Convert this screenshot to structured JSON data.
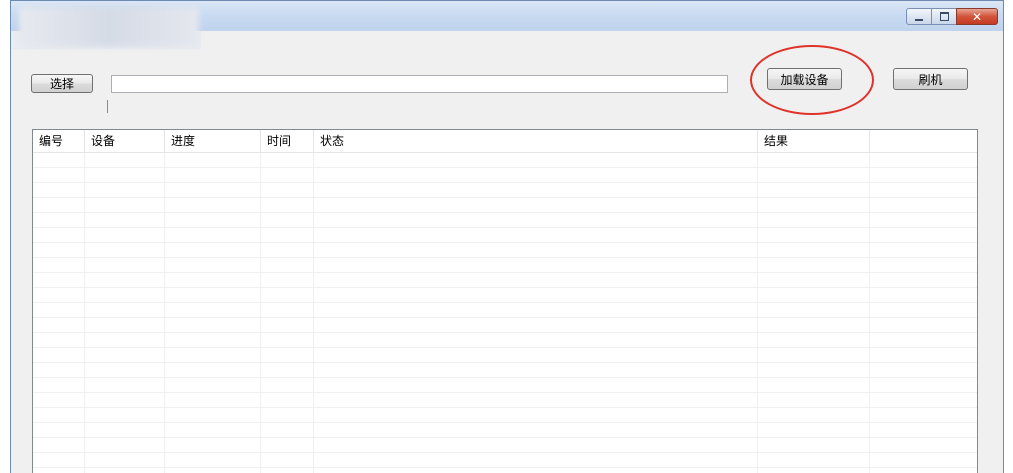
{
  "window": {
    "controls": {
      "minimize_icon": "minimize-icon",
      "maximize_icon": "maximize-icon",
      "close_icon": "close-icon",
      "close_glyph": "✕"
    }
  },
  "toolbar": {
    "select_label": "选择",
    "path_value": "",
    "load_device_label": "加载设备",
    "flash_label": "刷机"
  },
  "table": {
    "columns": [
      "编号",
      "设备",
      "进度",
      "时间",
      "状态",
      "结果",
      ""
    ],
    "rows": []
  },
  "colors": {
    "highlight_ring": "#e0322a",
    "titlebar": "#c9dbf1"
  }
}
